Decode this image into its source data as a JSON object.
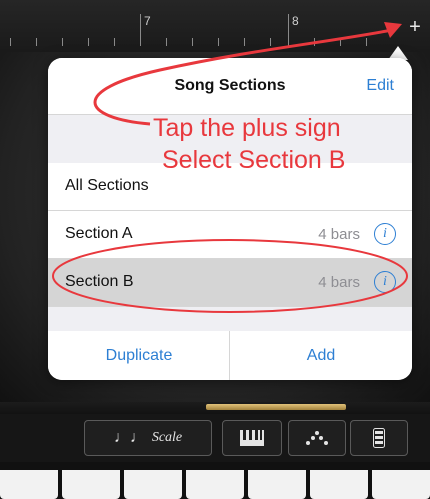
{
  "ruler": {
    "markers": [
      "7",
      "8"
    ],
    "plus_label": "+"
  },
  "popover": {
    "title": "Song Sections",
    "edit_label": "Edit",
    "sections": [
      {
        "label": "All Sections"
      },
      {
        "label": "Section A",
        "bars": "4 bars",
        "info": "i"
      },
      {
        "label": "Section B",
        "bars": "4 bars",
        "info": "i",
        "selected": true
      }
    ],
    "duplicate_label": "Duplicate",
    "add_label": "Add"
  },
  "annotation": {
    "line1": "Tap the plus sign",
    "line2": "Select Section B",
    "color": "#e8383d"
  },
  "controls": {
    "scale_notes": "♩♩",
    "scale_label": "Scale",
    "keys_icon": "piano-keys-icon",
    "arpeggio_icon": "arpeggiator-icon",
    "chord_icon": "chord-strip-icon"
  },
  "colors": {
    "accent": "#2d7fd3",
    "selected_row": "#d5d5d5"
  }
}
